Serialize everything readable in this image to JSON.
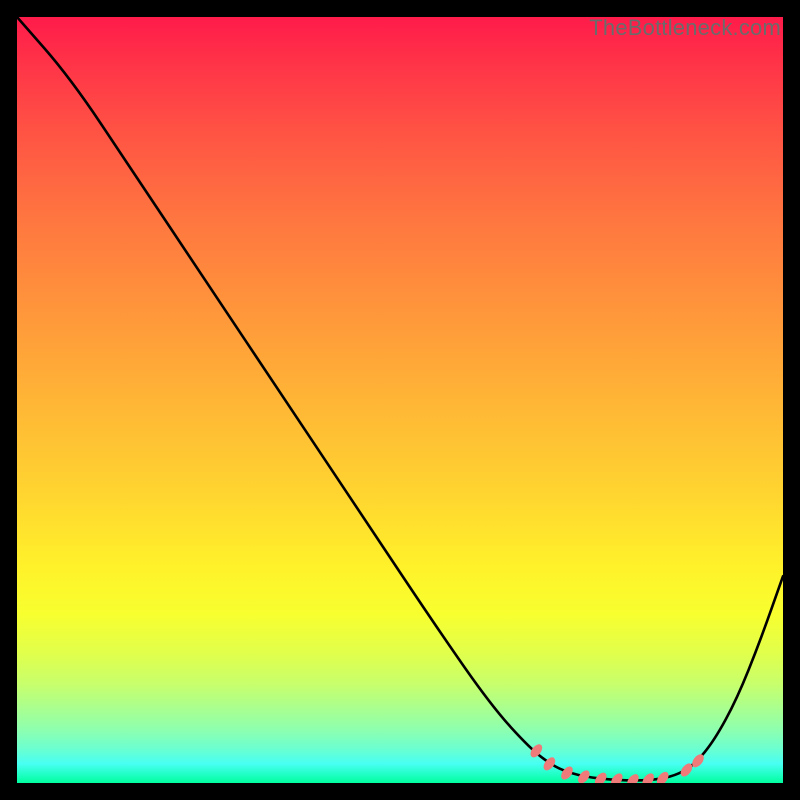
{
  "watermark": "TheBottleneck.com",
  "chart_data": {
    "type": "line",
    "title": "",
    "xlabel": "",
    "ylabel": "",
    "xlim": [
      0,
      100
    ],
    "ylim": [
      0,
      100
    ],
    "grid": false,
    "series": [
      {
        "name": "bottleneck-curve",
        "color": "#000000",
        "x": [
          0,
          7,
          15,
          25,
          35,
          45,
          55,
          62,
          67,
          70,
          72.5,
          75,
          78,
          81,
          84,
          86.5,
          88.5,
          91,
          94,
          97,
          100
        ],
        "y": [
          100,
          92,
          80,
          65,
          50,
          35,
          20,
          10,
          4.5,
          2.2,
          1.2,
          0.7,
          0.4,
          0.3,
          0.5,
          1.2,
          2.5,
          5.5,
          11,
          18.5,
          27
        ]
      }
    ],
    "markers": {
      "name": "plateau-markers",
      "color": "#ef7a7a",
      "shape": "lozenge",
      "points": [
        {
          "x": 67.8,
          "y": 4.2
        },
        {
          "x": 69.5,
          "y": 2.5
        },
        {
          "x": 71.8,
          "y": 1.3
        },
        {
          "x": 74.0,
          "y": 0.8
        },
        {
          "x": 76.2,
          "y": 0.5
        },
        {
          "x": 78.3,
          "y": 0.4
        },
        {
          "x": 80.4,
          "y": 0.3
        },
        {
          "x": 82.4,
          "y": 0.4
        },
        {
          "x": 84.3,
          "y": 0.6
        },
        {
          "x": 87.4,
          "y": 1.7
        },
        {
          "x": 88.9,
          "y": 2.9
        }
      ]
    },
    "background_gradient": {
      "top": "#ff1b4a",
      "mid_upper": "#ff953b",
      "mid": "#ffd430",
      "mid_lower": "#fff22a",
      "bottom": "#00ff9f"
    }
  }
}
